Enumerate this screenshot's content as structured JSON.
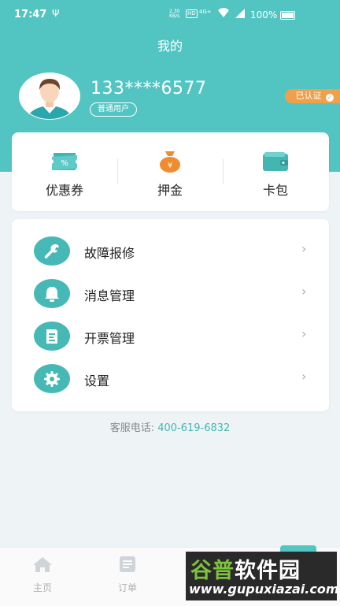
{
  "status_bar": {
    "time": "17:47",
    "usb_icon": "usb-icon",
    "speed": "2.30\nKB/s",
    "hd": "HD",
    "network": "4G+",
    "battery": "100%"
  },
  "header": {
    "title": "我的"
  },
  "profile": {
    "avatar_icon": "user-avatar",
    "phone": "133****6577",
    "user_type": "普通用户",
    "verified": "已认证"
  },
  "quick_actions": [
    {
      "label": "优惠券",
      "icon": "coupon-icon"
    },
    {
      "label": "押金",
      "icon": "deposit-bag-icon"
    },
    {
      "label": "卡包",
      "icon": "wallet-icon"
    }
  ],
  "menu": [
    {
      "label": "故障报修",
      "icon": "wrench-icon"
    },
    {
      "label": "消息管理",
      "icon": "bell-icon"
    },
    {
      "label": "开票管理",
      "icon": "invoice-icon"
    },
    {
      "label": "设置",
      "icon": "gear-icon"
    }
  ],
  "service": {
    "label": "客服电话:",
    "number": "400-619-6832"
  },
  "tabs": [
    {
      "label": "主页",
      "icon": "home-icon"
    },
    {
      "label": "订单",
      "icon": "order-icon"
    }
  ],
  "watermark": {
    "brand_a": "谷普",
    "brand_b": "软件园",
    "url": "www.gupuxiazai.com"
  },
  "colors": {
    "primary": "#52c5c3",
    "accent_orange": "#f0a04b",
    "icon_circle": "#46b9b6"
  }
}
